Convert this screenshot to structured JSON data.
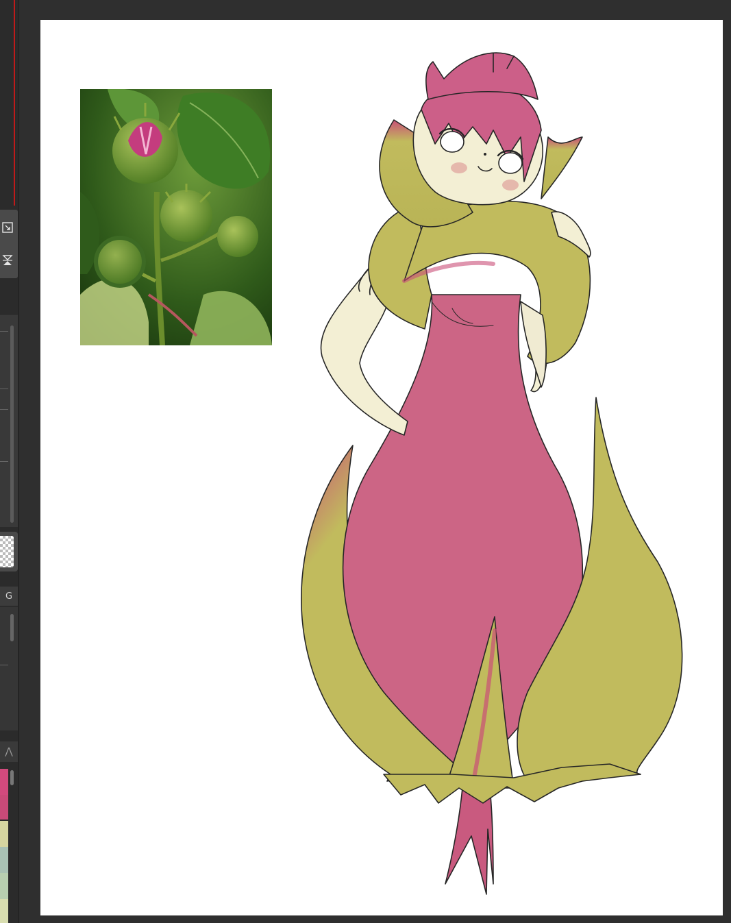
{
  "toolbar": {
    "tool_icons": [
      "resize-corner-icon",
      "flip-vertical-icon"
    ],
    "tab_g_label": "G",
    "lambda_icon": "caret-up-icon"
  },
  "swatches": [
    "#d14a7d",
    "#c94a78",
    "#d6d6a0",
    "#a9c2b4",
    "#b8cfb0",
    "#d9deb0"
  ],
  "colors": {
    "app_bg": "#2f2f2f",
    "canvas_bg": "#ffffff",
    "accent_red": "#c01a1a",
    "dress_pink": "#cc6585",
    "leaf_olive": "#c1bb5d",
    "skin": "#f3efd4"
  }
}
